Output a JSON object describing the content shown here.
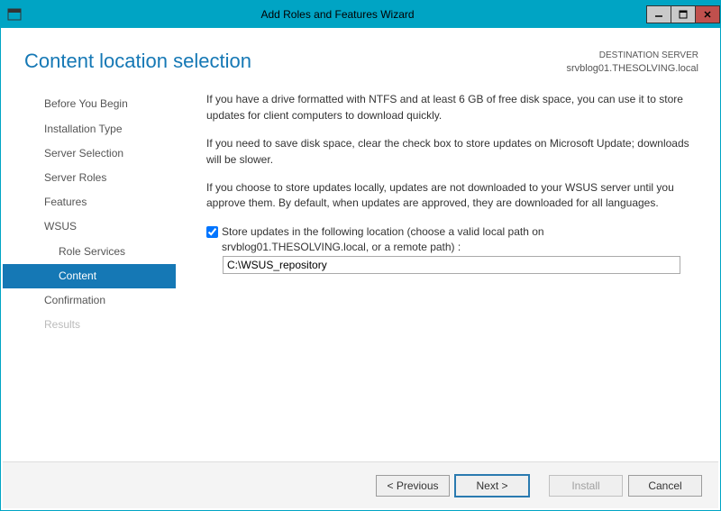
{
  "titlebar": {
    "title": "Add Roles and Features Wizard"
  },
  "header": {
    "title": "Content location selection",
    "destination_label": "DESTINATION SERVER",
    "destination_value": "srvblog01.THESOLVING.local"
  },
  "sidebar": {
    "items": [
      {
        "label": "Before You Begin",
        "level": 1
      },
      {
        "label": "Installation Type",
        "level": 1
      },
      {
        "label": "Server Selection",
        "level": 1
      },
      {
        "label": "Server Roles",
        "level": 1
      },
      {
        "label": "Features",
        "level": 1
      },
      {
        "label": "WSUS",
        "level": 1
      },
      {
        "label": "Role Services",
        "level": 2
      },
      {
        "label": "Content",
        "level": 2,
        "active": true
      },
      {
        "label": "Confirmation",
        "level": 1
      },
      {
        "label": "Results",
        "level": 1,
        "disabled": true
      }
    ]
  },
  "content": {
    "p1": "If you have a drive formatted with NTFS and at least 6 GB of free disk space, you can use it to store updates for client computers to download quickly.",
    "p2": "If you need to save disk space, clear the check box to store updates on Microsoft Update; downloads will be slower.",
    "p3": "If you choose to store updates locally, updates are not downloaded to your WSUS server until you approve them. By default, when updates are approved, they are downloaded for all languages.",
    "checkbox_label_line1": "Store updates in the following location (choose a valid local path on",
    "checkbox_label_line2": "srvblog01.THESOLVING.local, or a remote path) :",
    "path_value": "C:\\WSUS_repository",
    "checkbox_checked": true
  },
  "footer": {
    "previous": "< Previous",
    "next": "Next >",
    "install": "Install",
    "cancel": "Cancel"
  }
}
